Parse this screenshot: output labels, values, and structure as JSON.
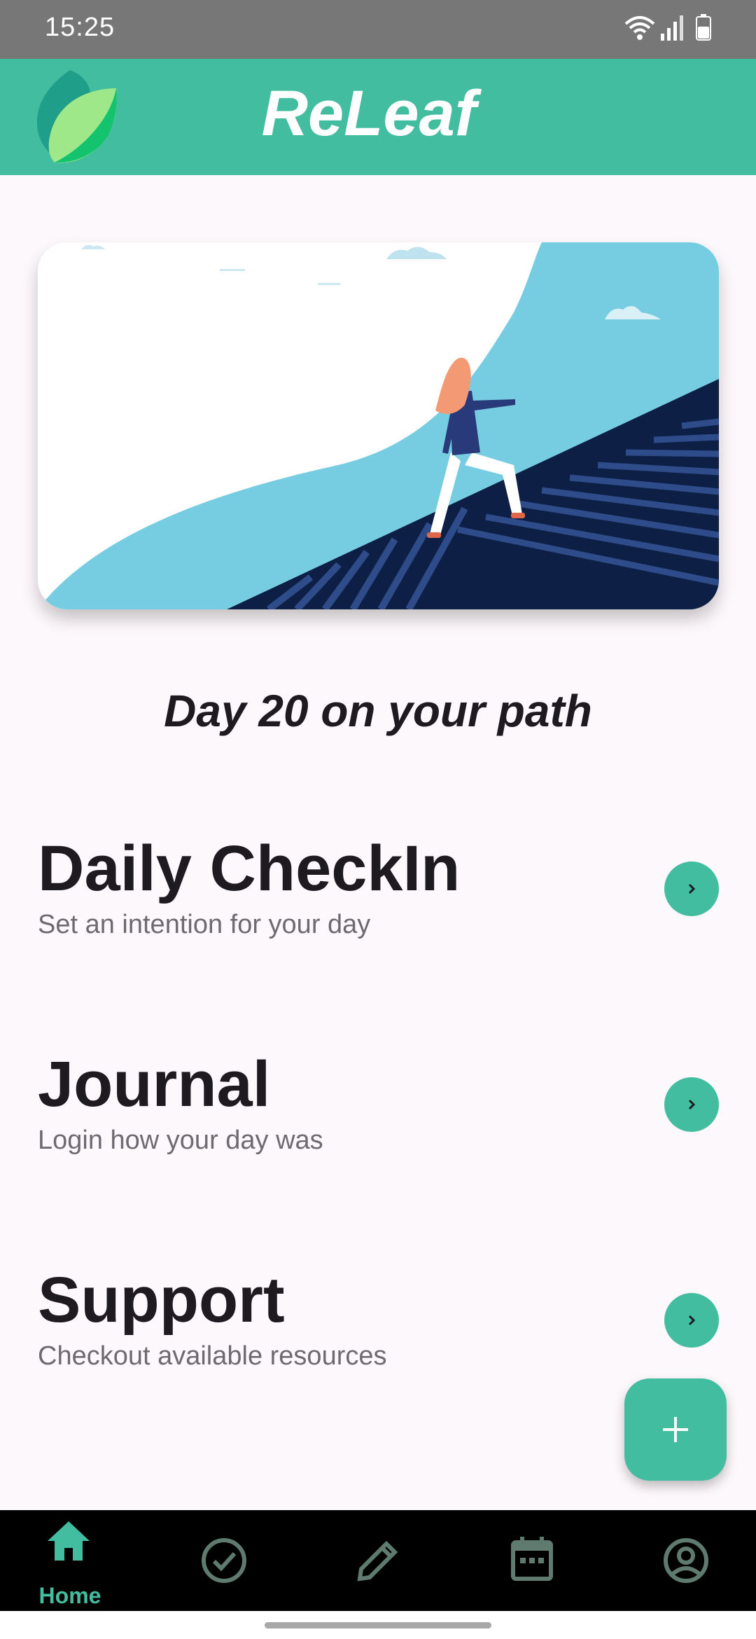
{
  "status_bar": {
    "time": "15:25",
    "icons": [
      "wifi-icon",
      "signal-icon",
      "battery-icon"
    ]
  },
  "app_bar": {
    "title": "ReLeaf",
    "logo_icon": "leaf-logo-icon"
  },
  "hero": {
    "image_description": "woman-climbing-stairs-illustration"
  },
  "progress": {
    "text": "Day 20 on your path"
  },
  "menu": [
    {
      "title": "Daily CheckIn",
      "subtitle": "Set an intention for your day",
      "icon": "chevron-right-icon"
    },
    {
      "title": "Journal",
      "subtitle": "Login how your day was",
      "icon": "chevron-right-icon"
    },
    {
      "title": "Support",
      "subtitle": "Checkout available resources",
      "icon": "chevron-right-icon"
    }
  ],
  "fab": {
    "icon": "plus-icon"
  },
  "bottom_nav": {
    "items": [
      {
        "label": "Home",
        "icon": "home-icon",
        "active": true
      },
      {
        "label": "",
        "icon": "check-circle-icon",
        "active": false
      },
      {
        "label": "",
        "icon": "pencil-icon",
        "active": false
      },
      {
        "label": "",
        "icon": "calendar-icon",
        "active": false
      },
      {
        "label": "",
        "icon": "account-circle-icon",
        "active": false
      }
    ]
  },
  "colors": {
    "accent": "#43bd9f",
    "status_bar": "#777777",
    "background": "#fdf8fc",
    "nav_background": "#000000",
    "inactive_icon": "#5f7a6e"
  }
}
